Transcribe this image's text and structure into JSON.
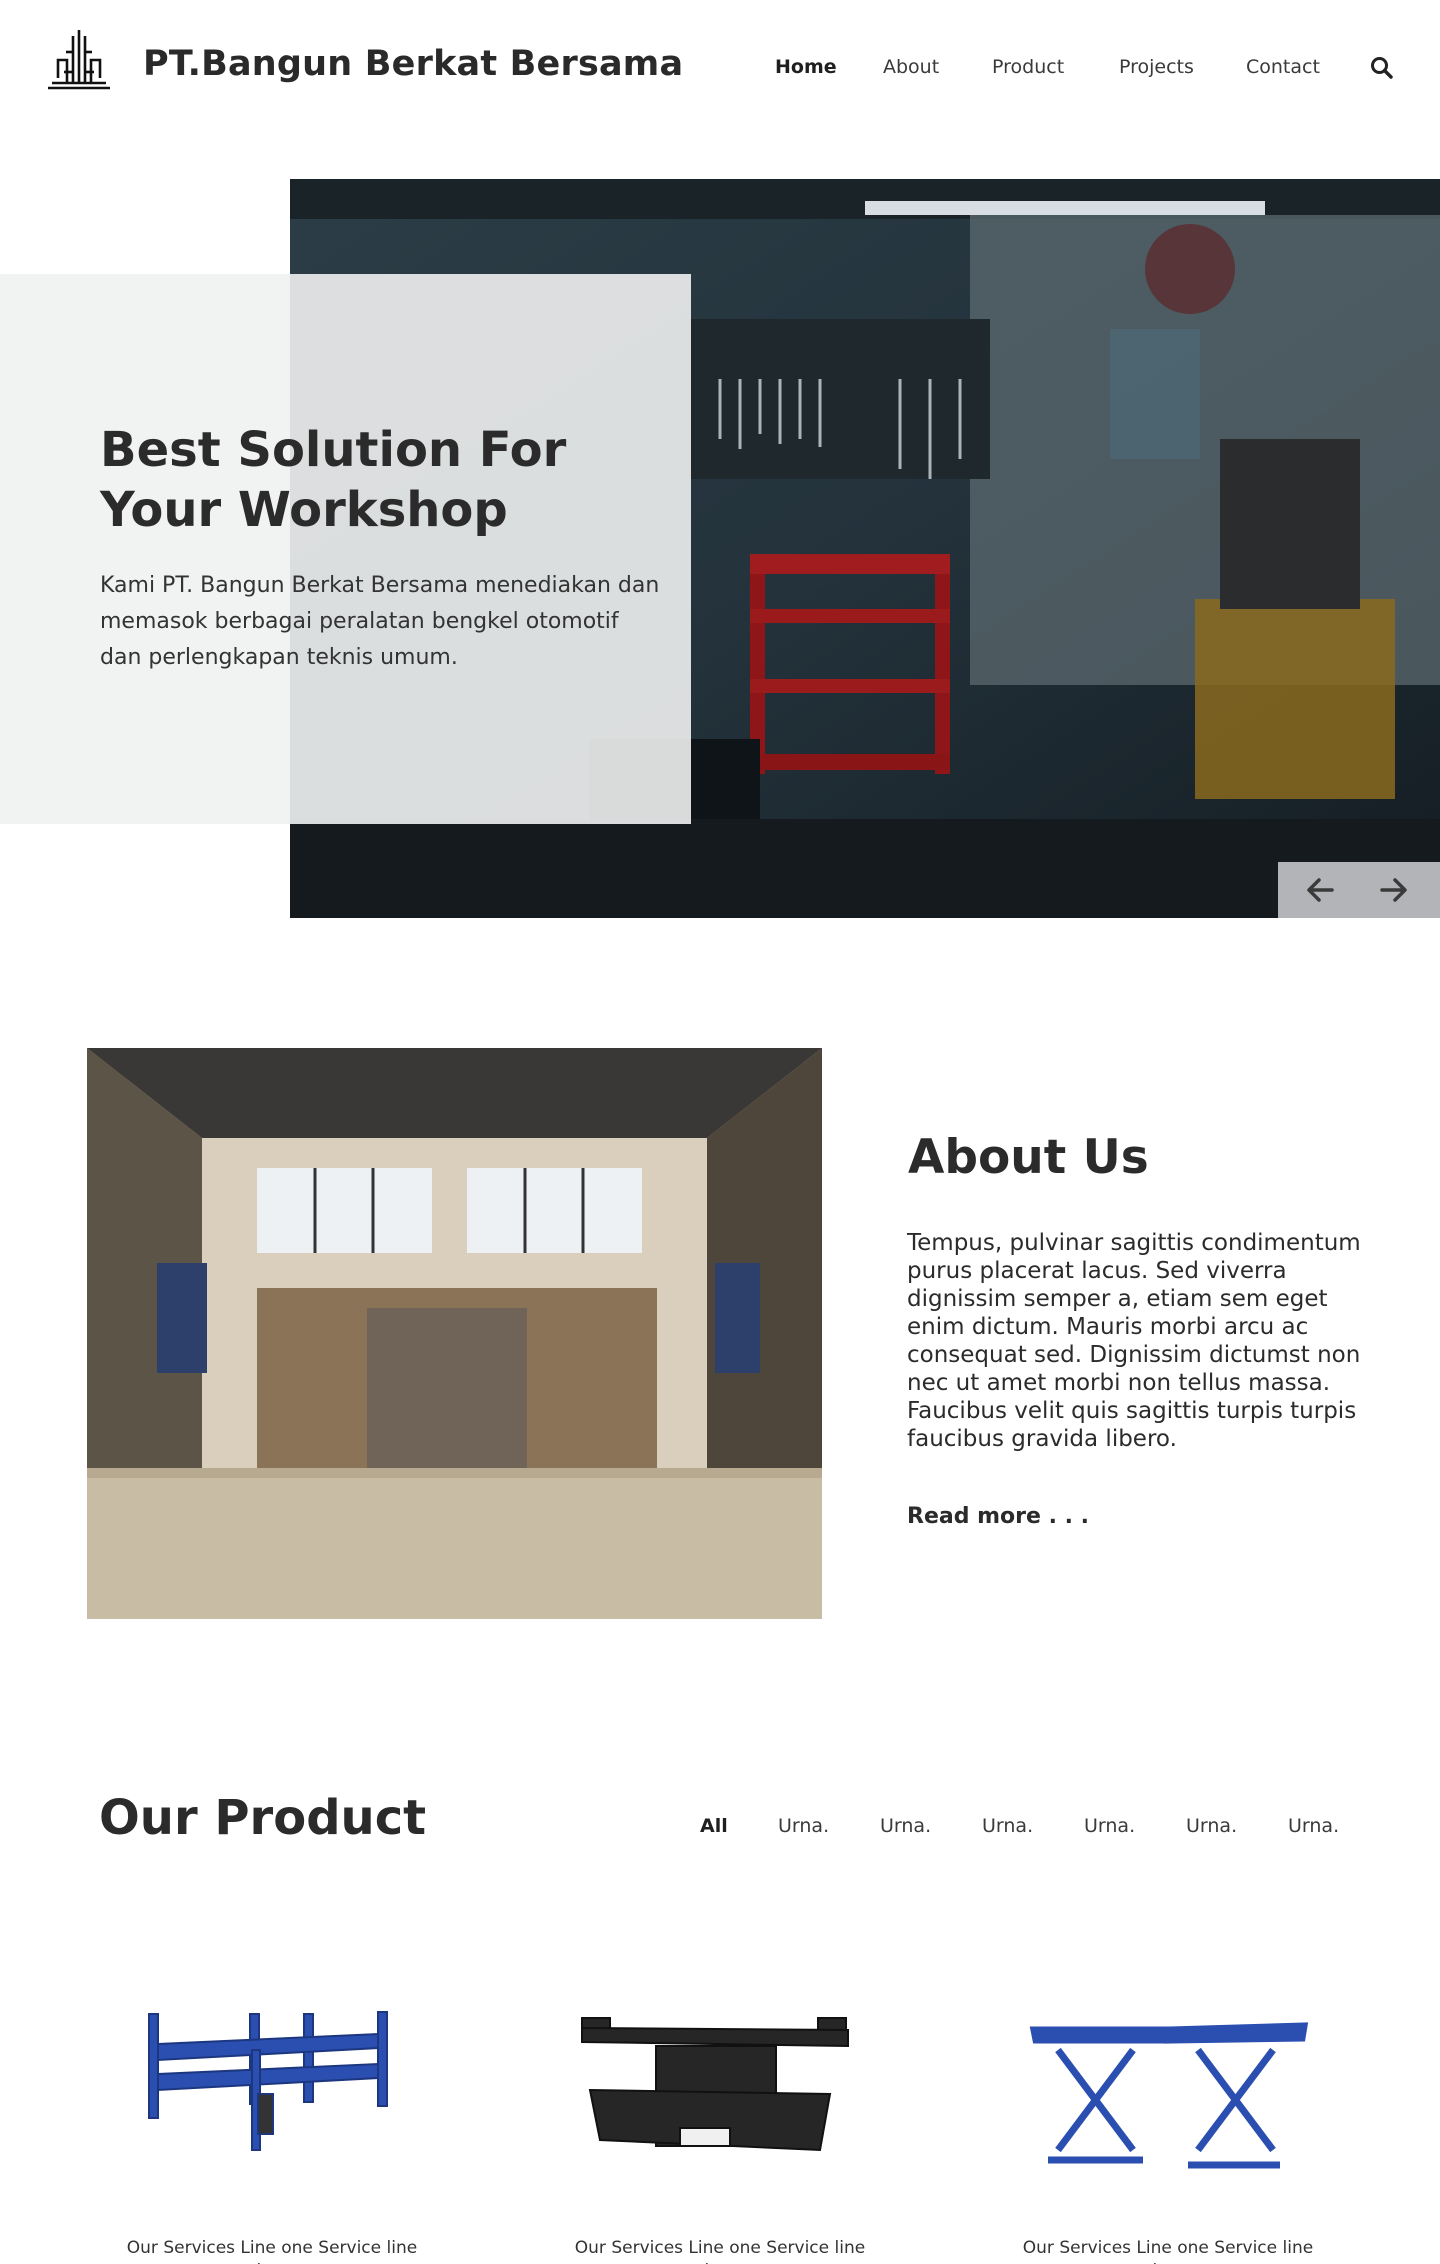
{
  "header": {
    "brand": "PT.Bangun Berkat Bersama",
    "logo_icon": "building-logo-icon",
    "nav": [
      {
        "label": "Home",
        "active": true
      },
      {
        "label": "About",
        "active": false
      },
      {
        "label": "Product",
        "active": false
      },
      {
        "label": "Projects",
        "active": false
      },
      {
        "label": "Contact",
        "active": false
      }
    ],
    "search_icon": "search-icon"
  },
  "hero": {
    "title": "Best Solution For Your Workshop",
    "text": "Kami PT. Bangun Berkat Bersama menediakan dan memasok berbagai peralatan bengkel otomotif dan perlengkapan teknis umum.",
    "prev_icon": "arrow-left-icon",
    "next_icon": "arrow-right-icon"
  },
  "about": {
    "title": "About Us",
    "text": "Tempus, pulvinar sagittis condimentum purus placerat lacus. Sed viverra dignissim semper a, etiam sem eget enim dictum. Mauris morbi arcu ac consequat sed. Dignissim dictumst non nec ut amet morbi non tellus massa. Faucibus velit quis sagittis turpis turpis faucibus gravida libero.",
    "read_more": "Read more . . ."
  },
  "product": {
    "title": "Our Product",
    "filters": [
      {
        "label": "All",
        "active": true
      },
      {
        "label": "Urna.",
        "active": false
      },
      {
        "label": "Urna.",
        "active": false
      },
      {
        "label": "Urna.",
        "active": false
      },
      {
        "label": "Urna.",
        "active": false
      },
      {
        "label": "Urna.",
        "active": false
      },
      {
        "label": "Urna.",
        "active": false
      }
    ],
    "items": [
      {
        "caption": "Our Services Line one Service line two",
        "image": "four-post-lift"
      },
      {
        "caption": "Our Services Line one Service line two",
        "image": "jacking-beam"
      },
      {
        "caption": "Our Services Line one Service line two",
        "image": "scissor-lift"
      }
    ]
  },
  "colors": {
    "text": "#2b2b2b",
    "panel": "#f0f1f1",
    "lift_blue": "#2a4fb0"
  }
}
